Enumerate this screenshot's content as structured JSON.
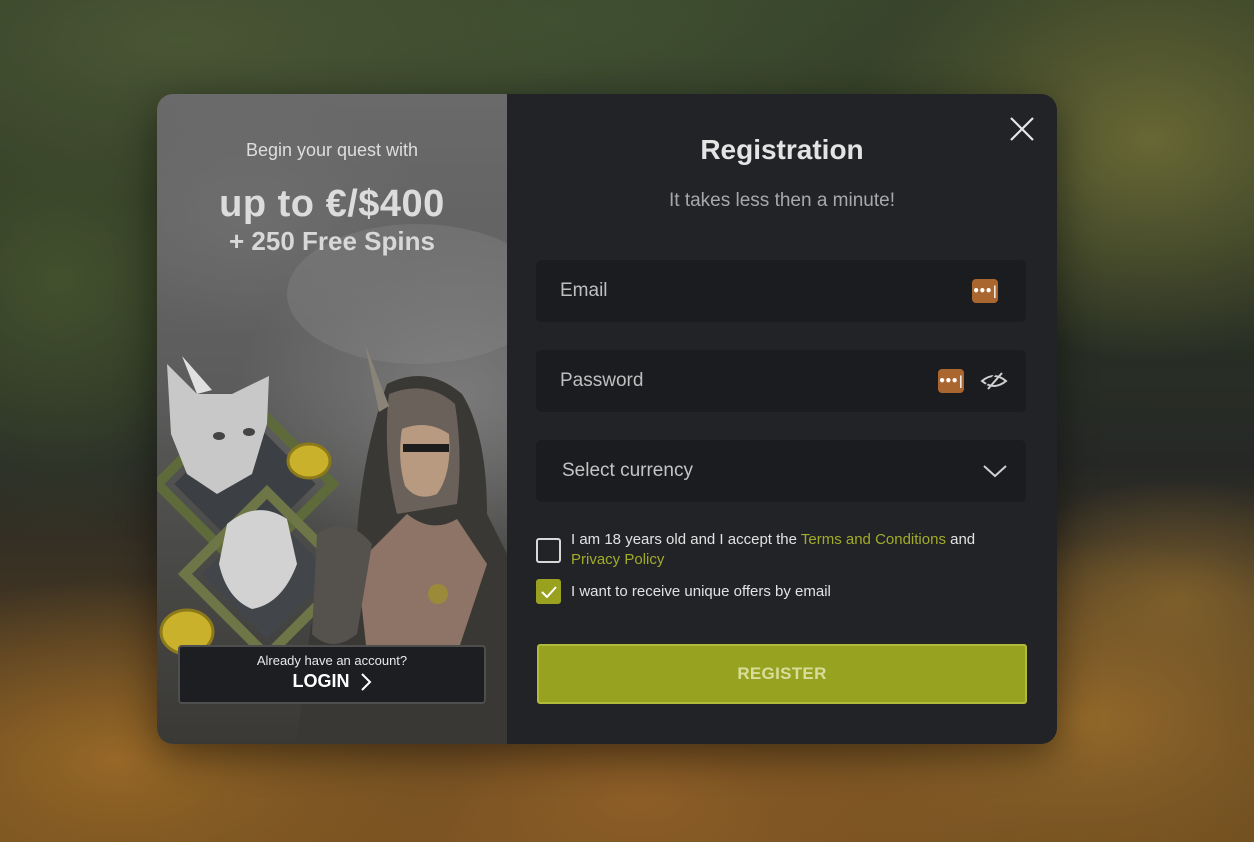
{
  "promo": {
    "lead": "Begin your quest with",
    "amount": "up to €/$400",
    "spins": "+ 250 Free Spins",
    "login_hint": "Already have an account?",
    "login_label": "LOGIN"
  },
  "form": {
    "title": "Registration",
    "subtitle": "It takes less then a minute!",
    "email_placeholder": "Email",
    "password_placeholder": "Password",
    "currency_placeholder": "Select currency",
    "password_manager_icon": "•••|",
    "terms": {
      "prefix": "I am 18 years old and I accept the ",
      "terms_link": "Terms and Conditions",
      "middle": " and",
      "privacy_link": "Privacy Policy",
      "checked": false
    },
    "offers": {
      "label": "I want to receive unique offers by email",
      "checked": true
    },
    "register_label": "REGISTER"
  },
  "colors": {
    "accent": "#97a221",
    "link": "#a2ab2a",
    "panel": "#212327",
    "input": "#1a1c20",
    "password_manager": "#a9662f"
  },
  "icons": [
    "close-icon",
    "password-manager-icon",
    "eye-slash-icon",
    "chevron-down-icon",
    "checkmark-icon",
    "chevron-right-icon"
  ]
}
